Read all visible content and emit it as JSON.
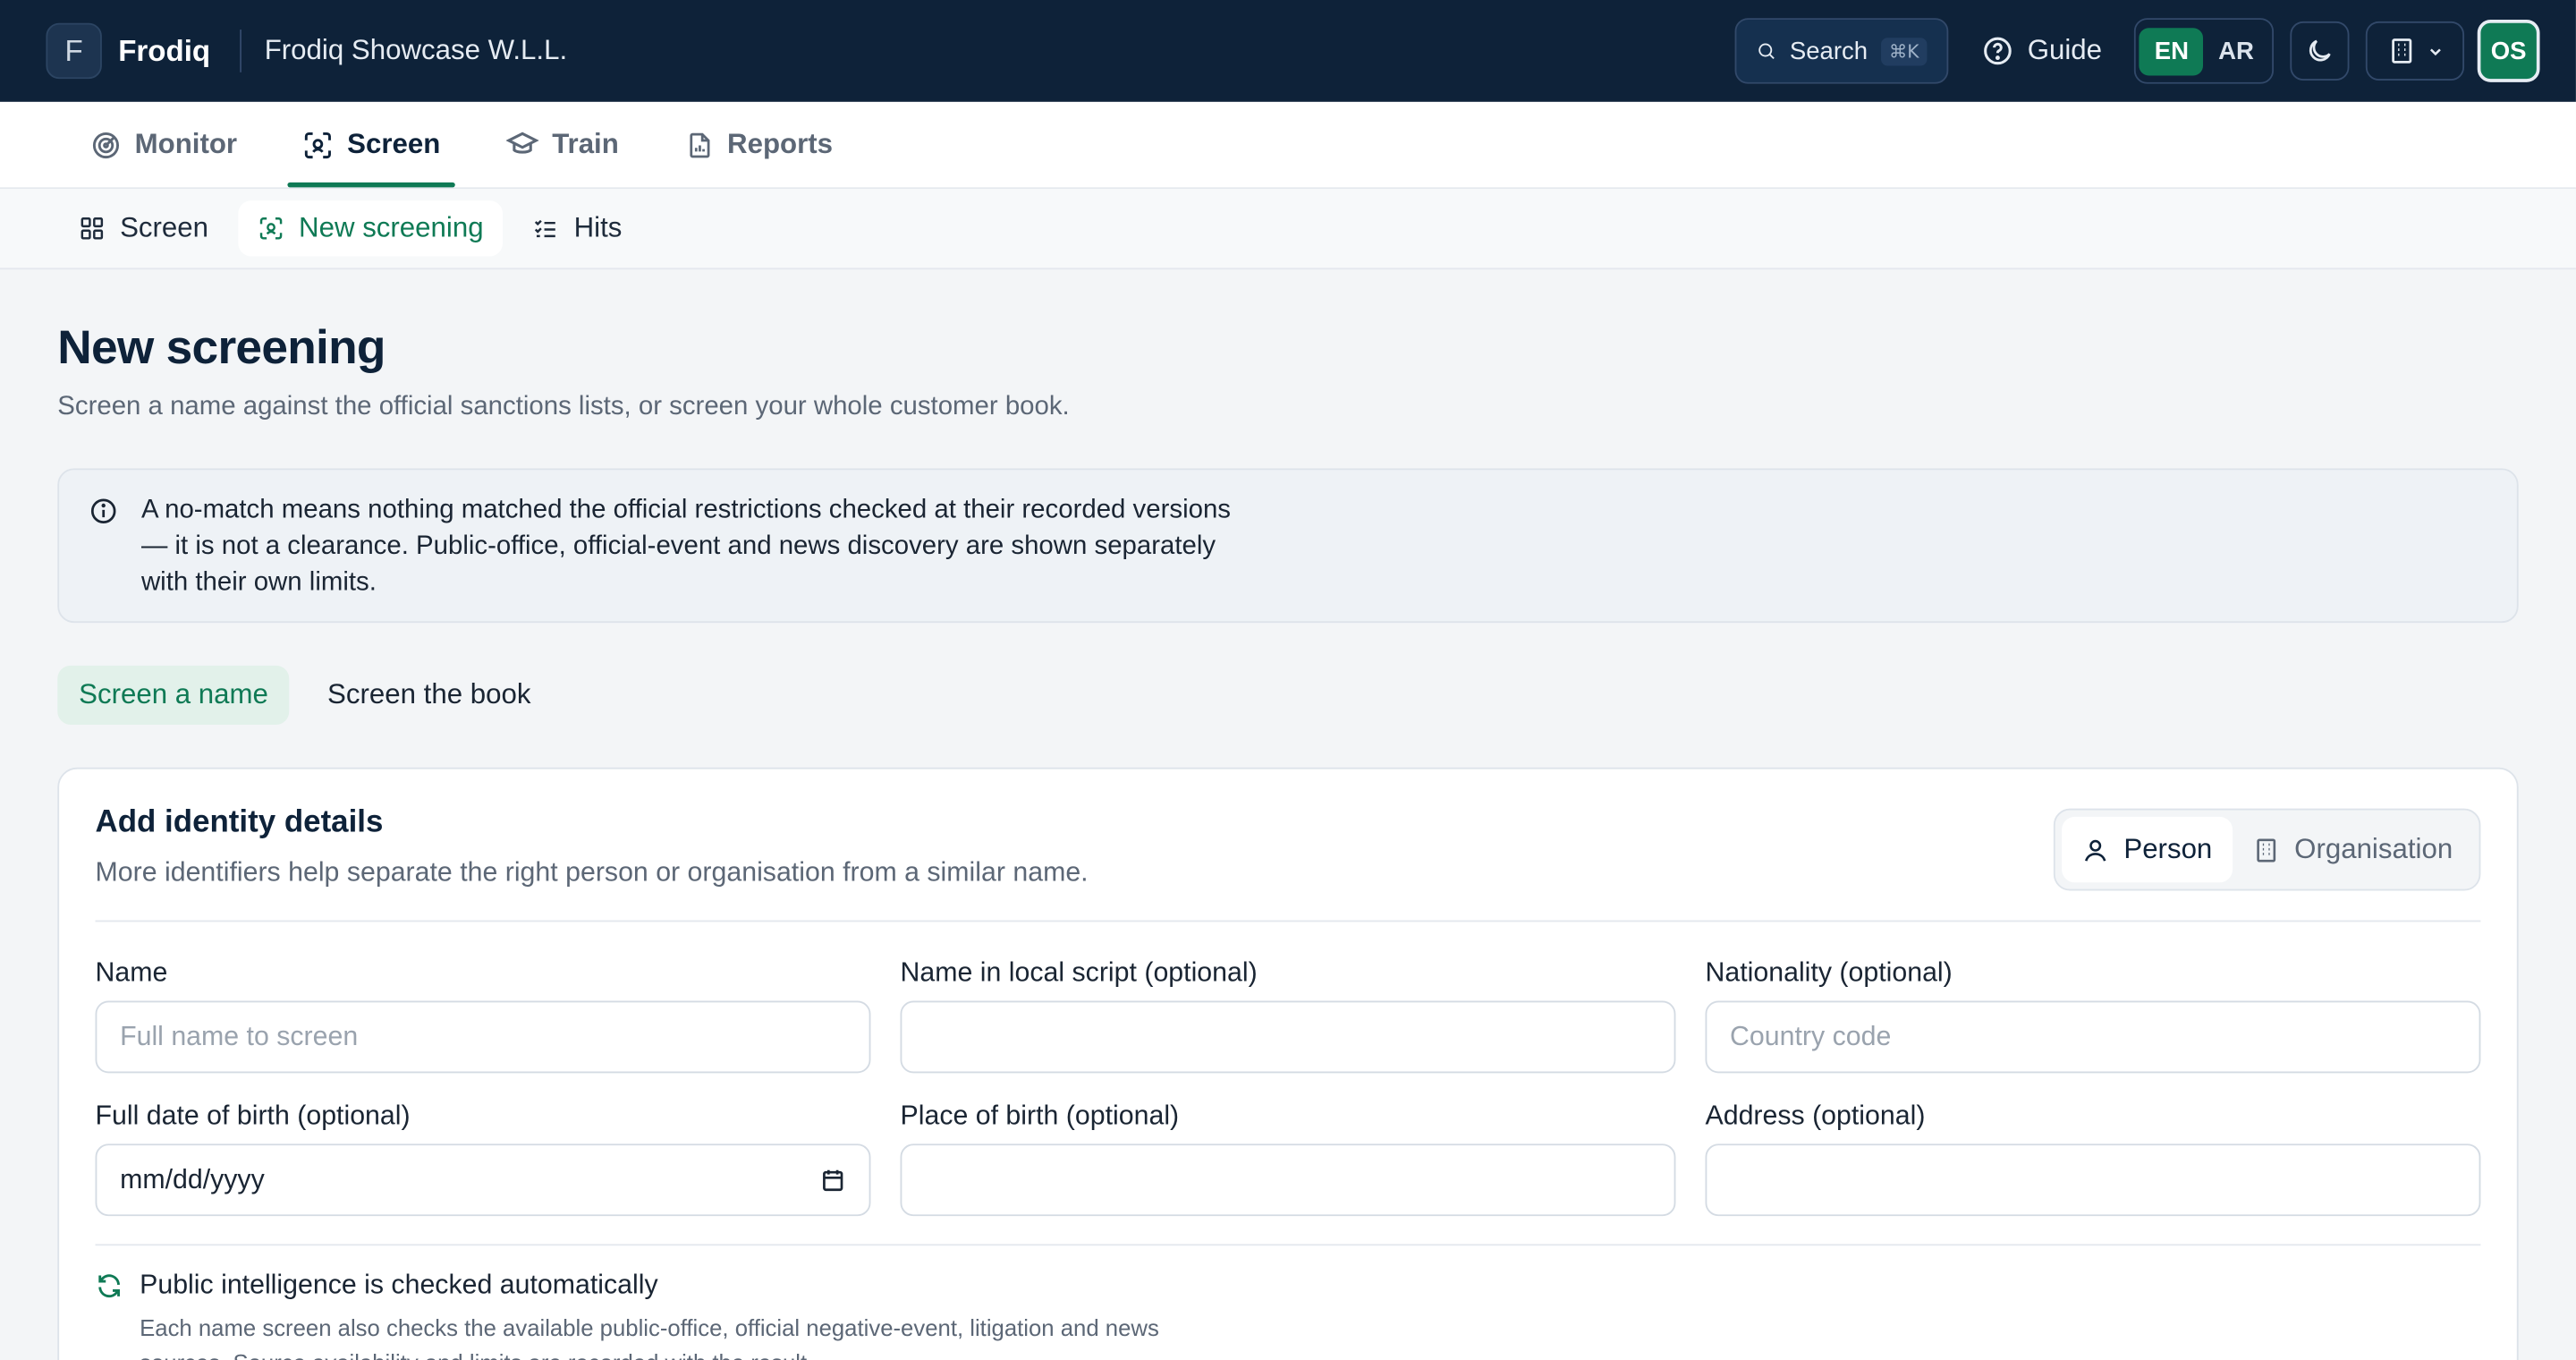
{
  "topbar": {
    "logo_letter": "F",
    "brand": "Frodiq",
    "org_name": "Frodiq Showcase W.L.L.",
    "search_label": "Search",
    "search_shortcut": "⌘K",
    "guide_label": "Guide",
    "lang_en": "EN",
    "lang_ar": "AR",
    "active_lang": "EN",
    "avatar_initials": "OS"
  },
  "nav_primary": {
    "items": [
      {
        "label": "Monitor",
        "icon": "radar-icon"
      },
      {
        "label": "Screen",
        "icon": "scan-face-icon"
      },
      {
        "label": "Train",
        "icon": "graduation-cap-icon"
      },
      {
        "label": "Reports",
        "icon": "report-icon"
      }
    ],
    "active": "Screen"
  },
  "nav_secondary": {
    "items": [
      {
        "label": "Screen",
        "icon": "grid-icon"
      },
      {
        "label": "New screening",
        "icon": "scan-face-icon"
      },
      {
        "label": "Hits",
        "icon": "checklist-icon"
      }
    ],
    "active": "New screening"
  },
  "page": {
    "title": "New screening",
    "subtitle": "Screen a name against the official sanctions lists, or screen your whole customer book.",
    "notice": "A no-match means nothing matched the official restrictions checked at their recorded versions — it is not a clearance. Public-office, official-event and news discovery are shown separately with their own limits."
  },
  "mode_tabs": {
    "name": "Screen a name",
    "book": "Screen the book",
    "active": "Screen a name"
  },
  "card": {
    "title": "Add identity details",
    "subtitle": "More identifiers help separate the right person or organisation from a similar name.",
    "type_person": "Person",
    "type_org": "Organisation",
    "active_type": "Person",
    "fields": {
      "name_label": "Name",
      "name_placeholder": "Full name to screen",
      "local_label": "Name in local script (optional)",
      "nationality_label": "Nationality (optional)",
      "nationality_placeholder": "Country code",
      "dob_label": "Full date of birth (optional)",
      "dob_value": "mm/dd/yyyy",
      "pob_label": "Place of birth (optional)",
      "address_label": "Address (optional)"
    },
    "auto_title": "Public intelligence is checked automatically",
    "auto_desc": "Each name screen also checks the available public-office, official negative-event, litigation and news sources. Source availability and limits are recorded with the result."
  },
  "colors": {
    "topbar": "#0e2239",
    "accent": "#0f7a55",
    "page_bg": "#f3f5f7"
  }
}
